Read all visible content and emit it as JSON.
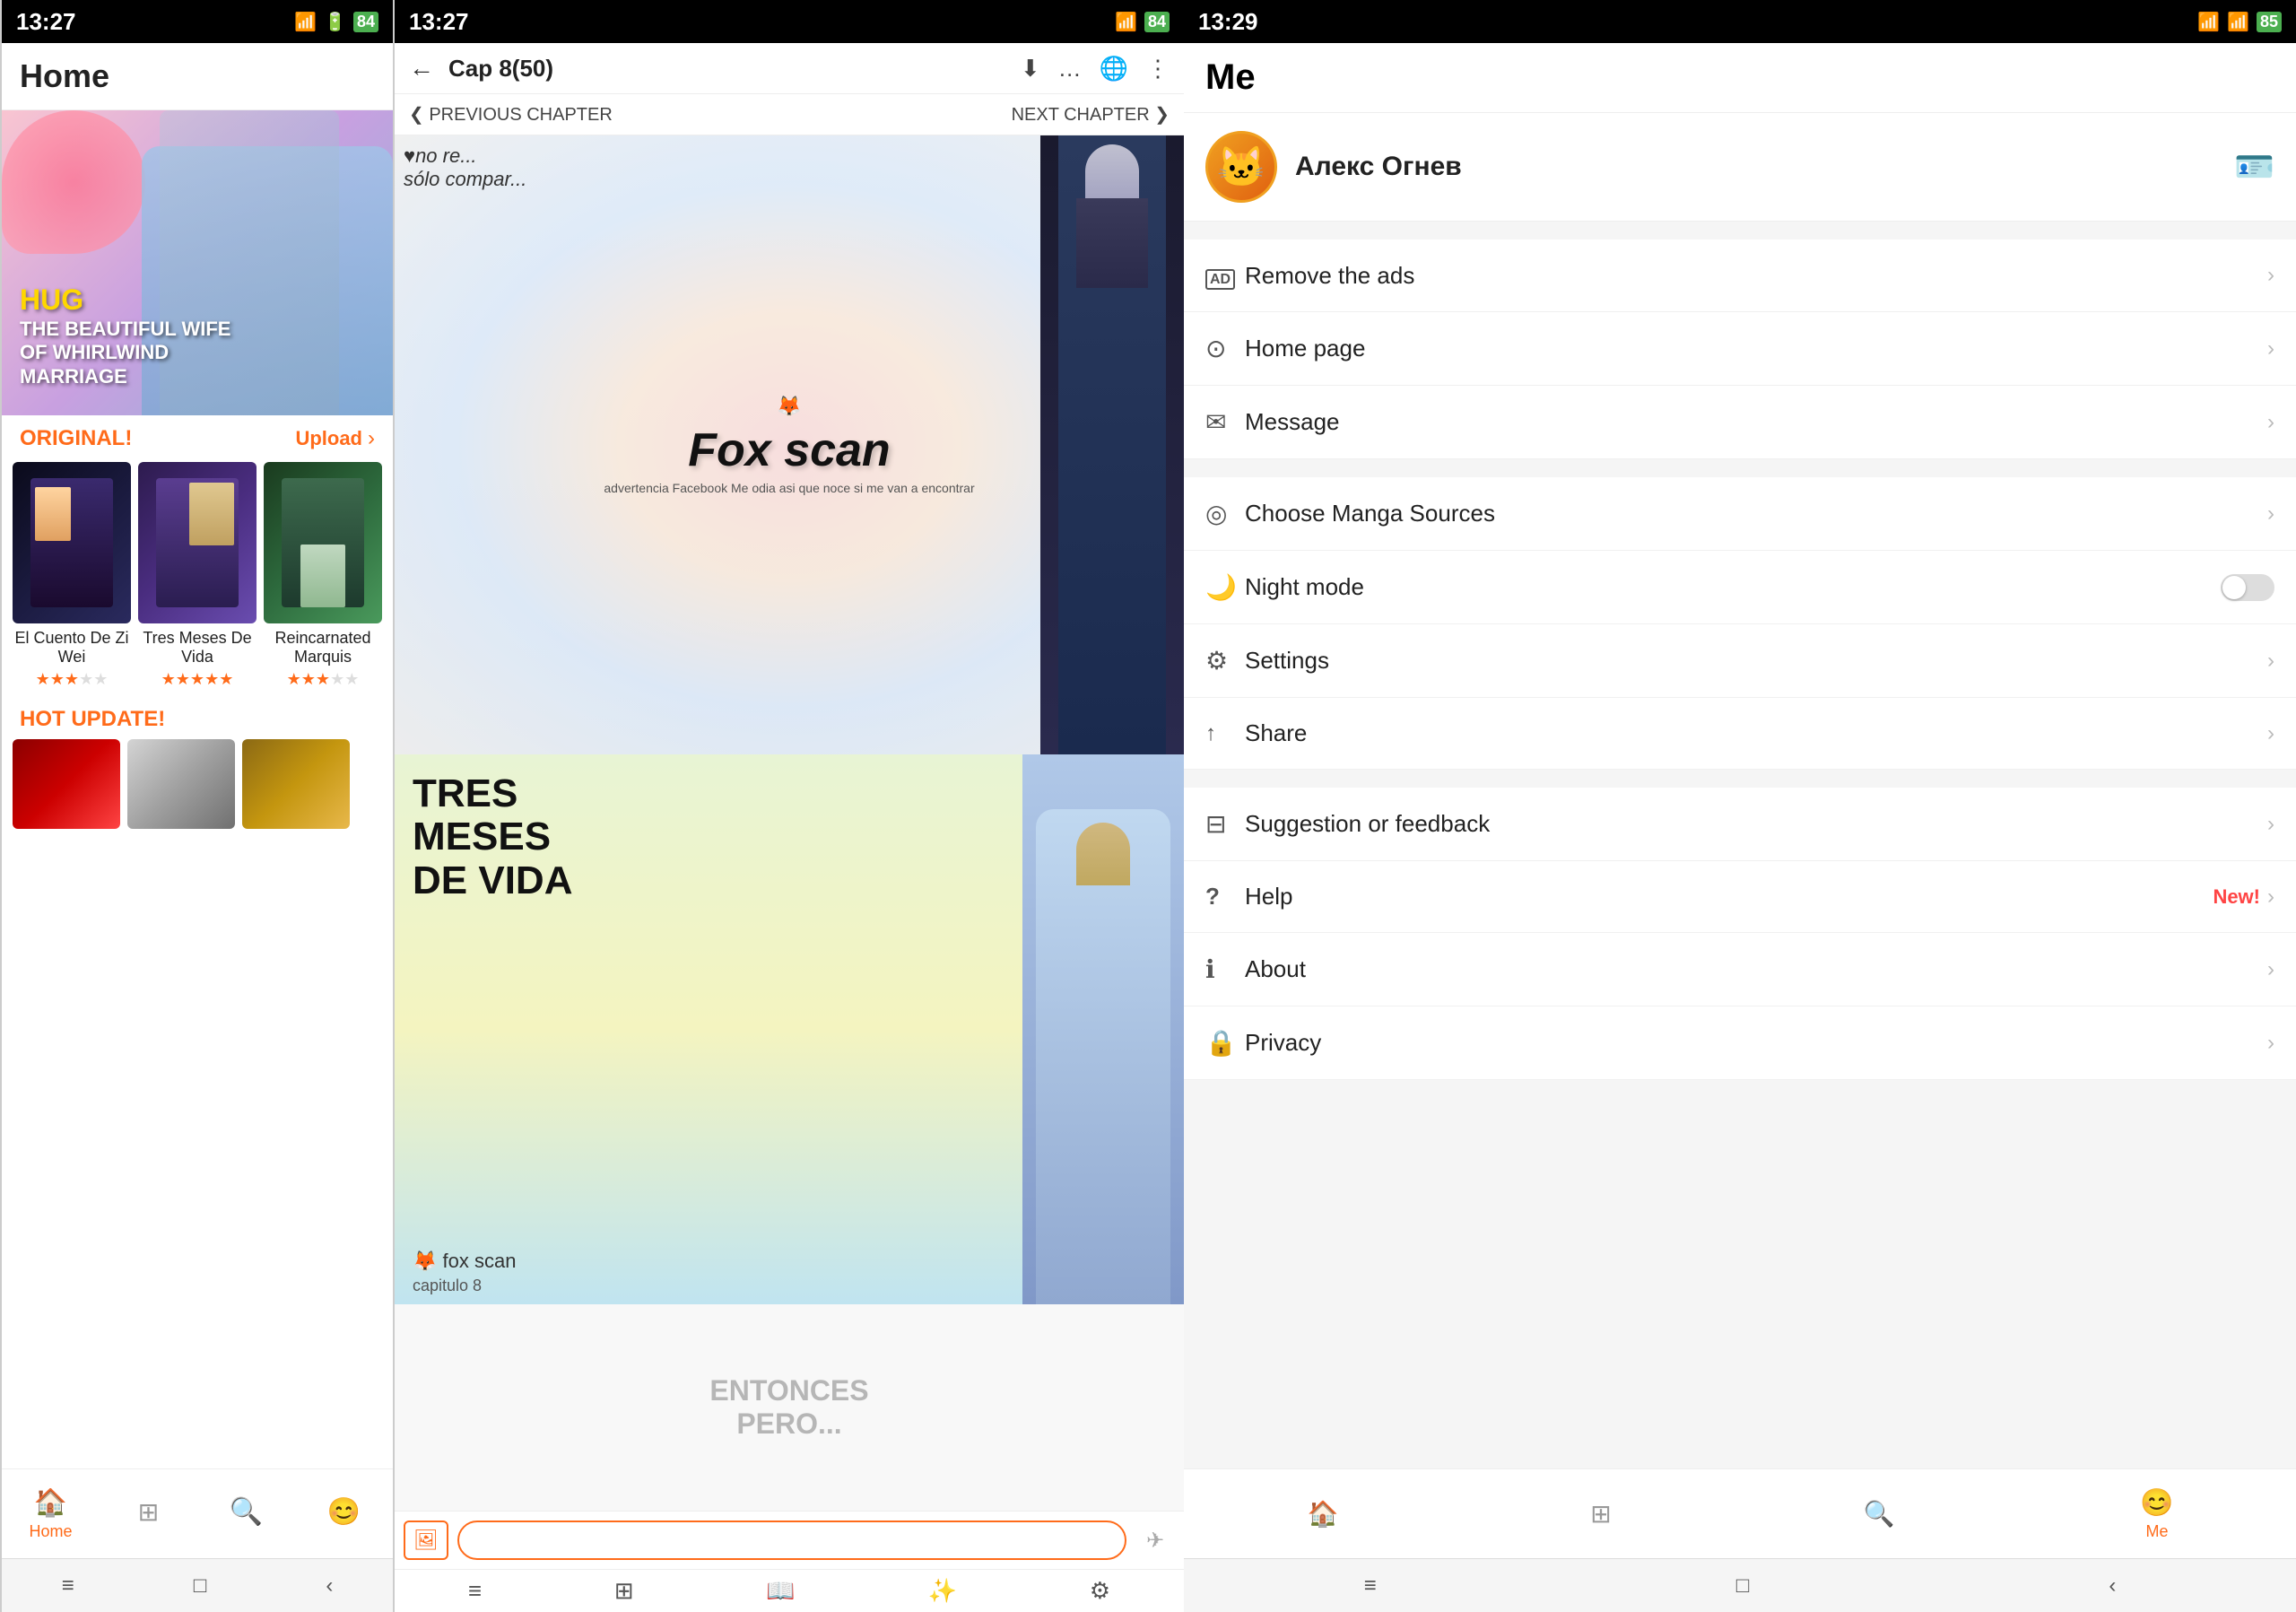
{
  "panel1": {
    "status": {
      "time": "13:27",
      "battery_icon": "🔋",
      "signal": "📶"
    },
    "header": {
      "title": "Home"
    },
    "banner": {
      "hug": "HUG",
      "title": "THE BEAUTIFUL WIFE\nOF WHIRLWIND\nMARRIAGE"
    },
    "original_section": {
      "label": "ORIGINAL!",
      "upload": "Upload",
      "arrow": "›"
    },
    "manga_cards": [
      {
        "title": "El Cuento De Zi Wei",
        "stars": "★★★½☆"
      },
      {
        "title": "Tres Meses De Vida",
        "stars": "★★★★★"
      },
      {
        "title": "Reincarnated Marquis",
        "stars": "★★★½☆"
      }
    ],
    "hot_update": {
      "label": "HOT UPDATE!"
    },
    "nav": [
      {
        "icon": "🏠",
        "label": "Home",
        "active": true
      },
      {
        "icon": "🏠",
        "label": "",
        "active": false
      },
      {
        "icon": "🔍",
        "label": "",
        "active": false
      },
      {
        "icon": "😊",
        "label": "",
        "active": false
      }
    ],
    "android_nav": [
      "≡",
      "□",
      "‹"
    ]
  },
  "panel2": {
    "status": {
      "time": "13:27"
    },
    "header": {
      "back": "←",
      "chapter": "Cap 8(50)",
      "icons": [
        "⬇",
        "…",
        "🌐",
        "⋮"
      ]
    },
    "chapter_nav": {
      "prev": "❮ PREVIOUS CHAPTER",
      "next": "NEXT CHAPTER ❯"
    },
    "pages": [
      {
        "overlay_text": "♥no re...\nsólo compar...",
        "logo": "Fox scan",
        "subtitle": "advertencia Facebook Me odia asi que noce si me van a encontrar"
      },
      {
        "title_line1": "TRES",
        "title_line2": "MESES",
        "title_line3": "DE VIDA",
        "caption": "fox scan",
        "chapter_label": "capitulo 8"
      }
    ],
    "bottom": {
      "image_icon": "🖼",
      "send_icon": "✈",
      "placeholder": ""
    },
    "bottom_bar_icons": [
      "≡",
      "⊞",
      "📖",
      "✨",
      "⚙"
    ]
  },
  "panel3": {
    "status": {
      "time": "13:29"
    },
    "header": {
      "title": "Me"
    },
    "profile": {
      "name": "Алекс Огнев",
      "avatar_emoji": "🐱",
      "edit_icon": "🪪"
    },
    "menu_sections": [
      {
        "items": [
          {
            "icon": "AD",
            "label": "Remove the ads",
            "type": "ad",
            "arrow": "›"
          },
          {
            "icon": "⊙",
            "label": "Home page",
            "arrow": "›"
          },
          {
            "icon": "✉",
            "label": "Message",
            "arrow": "›"
          }
        ]
      },
      {
        "items": [
          {
            "icon": "◎",
            "label": "Choose Manga Sources",
            "arrow": "›"
          },
          {
            "icon": "🌙",
            "label": "Night mode",
            "type": "toggle",
            "arrow": ""
          },
          {
            "icon": "⚙",
            "label": "Settings",
            "arrow": "›"
          },
          {
            "icon": "↑",
            "label": "Share",
            "arrow": "›"
          }
        ]
      },
      {
        "items": [
          {
            "icon": "⊟",
            "label": "Suggestion or feedback",
            "arrow": "›"
          },
          {
            "icon": "?",
            "label": "Help",
            "badge": "New!",
            "arrow": "›"
          },
          {
            "icon": "ℹ",
            "label": "About",
            "arrow": "›"
          },
          {
            "icon": "🔒",
            "label": "Privacy",
            "arrow": "›"
          }
        ]
      }
    ],
    "nav": [
      {
        "icon": "🏠",
        "label": "",
        "active": false
      },
      {
        "icon": "🏠",
        "label": "",
        "active": false
      },
      {
        "icon": "🔍",
        "label": "",
        "active": false
      },
      {
        "icon": "😊",
        "label": "Me",
        "active": true
      }
    ],
    "android_nav": [
      "≡",
      "□",
      "‹"
    ]
  }
}
